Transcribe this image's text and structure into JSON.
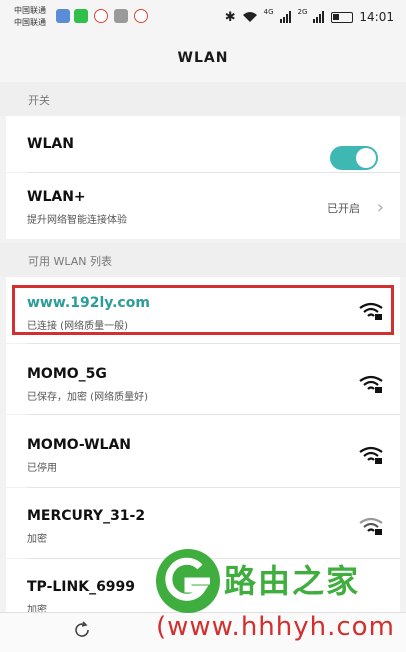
{
  "status_bar": {
    "carrier_1": "中国联通",
    "carrier_2": "中国联通",
    "signal_4g": "4G",
    "signal_2g": "2G",
    "time": "14:01"
  },
  "header": {
    "title": "WLAN"
  },
  "section_switch": {
    "label": "开关"
  },
  "wlan_toggle": {
    "label": "WLAN",
    "state": "on"
  },
  "wlan_plus": {
    "title": "WLAN+",
    "subtitle": "提升网络智能连接体验",
    "status": "已开启"
  },
  "section_networks": {
    "label": "可用 WLAN 列表"
  },
  "networks": [
    {
      "ssid": "www.192ly.com",
      "status": "已连接 (网络质量一般)"
    },
    {
      "ssid": "MOMO_5G",
      "status": "已保存，加密 (网络质量好)"
    },
    {
      "ssid": "MOMO-WLAN",
      "status": "已停用"
    },
    {
      "ssid": "MERCURY_31-2",
      "status": "加密"
    },
    {
      "ssid": "TP-LINK_6999",
      "status": "加密"
    }
  ],
  "bottom_nav": {
    "item_1_icon": "refresh-icon"
  },
  "watermark": {
    "brand": "路由之家",
    "url": "(www.hhhyh.com"
  },
  "colors": {
    "accent": "#3fb8b4",
    "highlight": "#d32f2f",
    "connected_text": "#2a9d9a",
    "watermark_green": "#3fae3f"
  }
}
